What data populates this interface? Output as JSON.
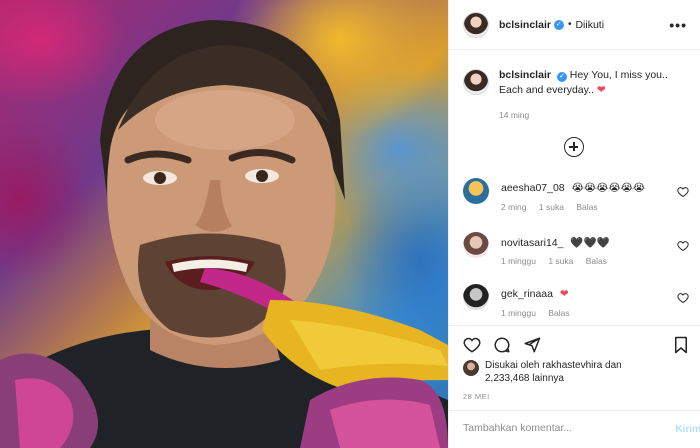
{
  "post": {
    "username": "bclsinclair",
    "verified_mark": "✓",
    "follow_state": "Diikuti",
    "menu_icon": "more-icon"
  },
  "caption": {
    "username": "bclsinclair",
    "text_line1": "Hey You, I miss you..",
    "text_line2": "Each and everyday..",
    "emoji": "❤",
    "time": "14 ming"
  },
  "comments": [
    {
      "username": "aeesha07_08",
      "text": "😭😭😭😭😭😭",
      "time": "2 ming",
      "likes": "1 suka",
      "reply": "Balas"
    },
    {
      "username": "novitasari14_",
      "text": "🖤🖤🖤",
      "time": "1 minggu",
      "likes": "1 suka",
      "reply": "Balas"
    },
    {
      "username": "gek_rinaaa",
      "text": "❤",
      "time": "1 minggu",
      "likes": "",
      "reply": "Balas"
    }
  ],
  "likes": {
    "line1": "Disukai oleh rakhastevhira dan",
    "line2": "2,233,468 lainnya"
  },
  "date": "28 MEI",
  "composer": {
    "placeholder": "Tambahkan komentar...",
    "post_label": "Kirim"
  },
  "colors": {
    "text": "#262626",
    "muted": "#8e8e8e",
    "accent": "#3897f0",
    "heart": "#ed4956",
    "post_disabled": "#b2dffc"
  },
  "icons": [
    "heart-icon",
    "comment-icon",
    "share-icon",
    "save-icon",
    "add-comment-icon"
  ]
}
